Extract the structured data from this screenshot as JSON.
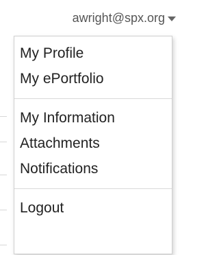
{
  "account": {
    "email": "awright@spx.org",
    "caret_icon": "caret-down-icon"
  },
  "menu": {
    "group1": [
      {
        "id": "my-profile",
        "label": "My Profile"
      },
      {
        "id": "my-eportfolio",
        "label": "My ePortfolio"
      }
    ],
    "group2": [
      {
        "id": "my-information",
        "label": "My Information"
      },
      {
        "id": "attachments",
        "label": "Attachments"
      },
      {
        "id": "notifications",
        "label": "Notifications"
      }
    ],
    "group3": [
      {
        "id": "logout",
        "label": "Logout"
      }
    ]
  }
}
